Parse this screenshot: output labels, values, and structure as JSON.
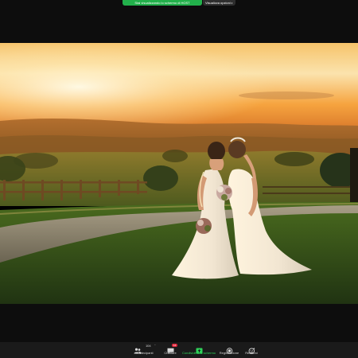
{
  "share_banner": {
    "status_text": "Stai visualizzando lo schermo di HOST",
    "view_options_label": "Visualizza opzioni",
    "view_options_icon": "chevron-down-icon"
  },
  "shared_content": {
    "kind": "photo",
    "subject": "two brides embracing at sunset in a field"
  },
  "toolbar": {
    "participants": {
      "label": "Partecipanti",
      "count": "104",
      "icon": "participants-icon"
    },
    "chat": {
      "label": "Chattare",
      "badge": "14",
      "icon": "chat-icon"
    },
    "share_screen": {
      "label": "Condividere lo schermo",
      "icon": "share-screen-icon"
    },
    "record": {
      "label": "Registrazione",
      "icon": "record-icon"
    },
    "reactions": {
      "label": "Reazioni",
      "icon": "reactions-icon"
    }
  },
  "colors": {
    "share_green": "#22b04b",
    "active_label_green": "#2fd35a",
    "chat_badge_red": "#e0283c",
    "toolbar_bg": "#1a1a1a",
    "window_bg": "#0d0d0d"
  }
}
